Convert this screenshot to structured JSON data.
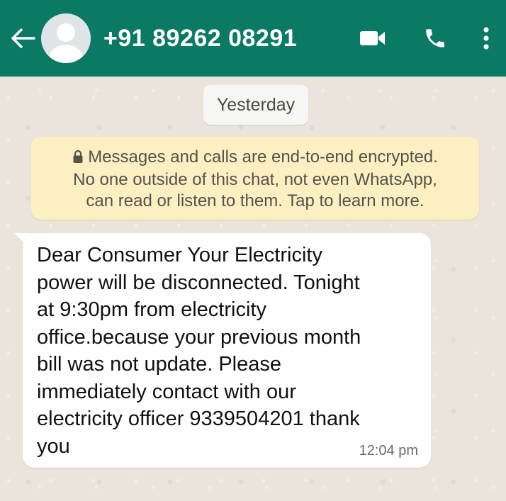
{
  "header": {
    "contact": "+91 89262 08291",
    "icons": {
      "back": "arrow-left-icon",
      "avatar": "default-avatar-icon",
      "video": "video-call-icon",
      "call": "phone-icon",
      "menu": "more-vertical-icon"
    },
    "background": "#0a7a64"
  },
  "date_chip": "Yesterday",
  "encryption_notice": {
    "line1": "Messages and calls are end-to-end encrypted.",
    "line2": "No one outside of this chat, not even WhatsApp,",
    "line3": "can read or listen to them. Tap to learn more.",
    "icon": "lock-icon",
    "background": "#fcefc2"
  },
  "message": {
    "text": "Dear Consumer Your Electricity\npower will be disconnected. Tonight\nat 9:30pm from electricity\noffice.because your previous month\nbill was not update. Please\nimmediately contact with our\nelectricity officer 9339504201 thank\nyou",
    "time": "12:04 pm"
  }
}
